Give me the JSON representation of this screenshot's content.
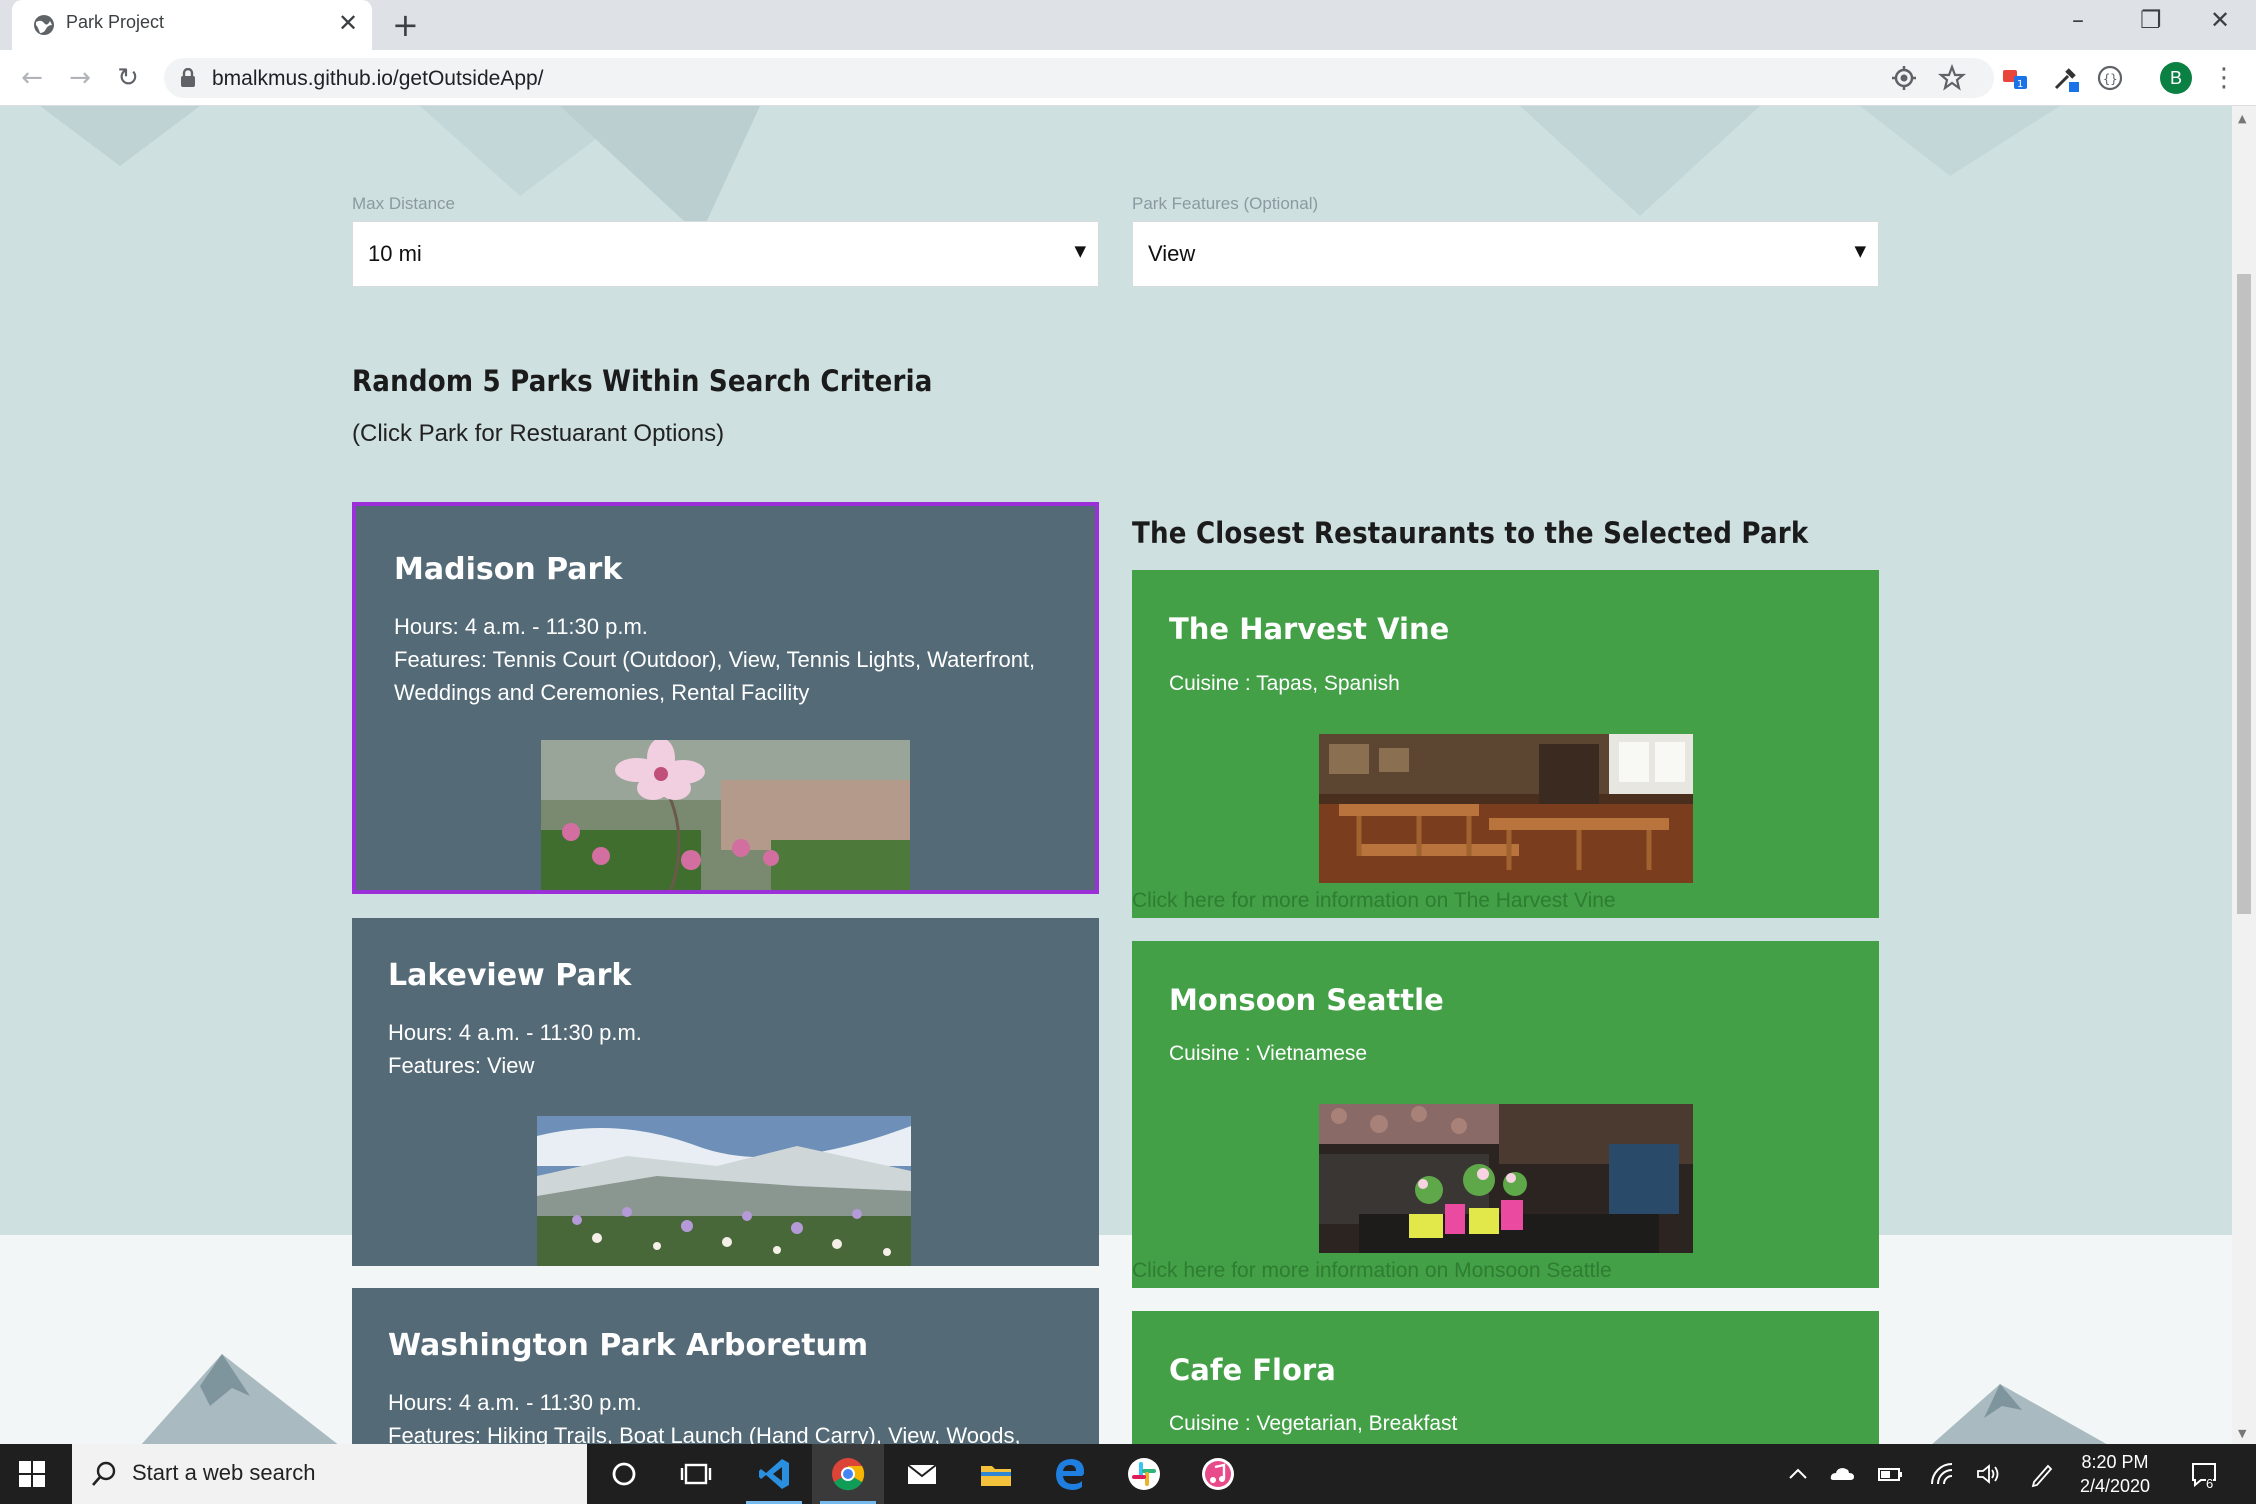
{
  "browser": {
    "tab_title": "Park Project",
    "url": "bmalkmus.github.io/getOutsideApp/",
    "profile_initial": "B"
  },
  "filters": {
    "distance_label": "Max Distance",
    "distance_value": "10 mi",
    "features_label": "Park Features (Optional)",
    "features_value": "View"
  },
  "parks_section": {
    "heading": "Random 5 Parks Within Search Criteria",
    "subheading": "(Click Park for Restuarant Options)"
  },
  "parks": [
    {
      "name": "Madison Park",
      "hours": "Hours: 4 a.m. - 11:30 p.m.",
      "features": "Features: Tennis Court (Outdoor), View, Tennis Lights, Waterfront, Weddings and Ceremonies, Rental Facility",
      "selected": true
    },
    {
      "name": "Lakeview Park",
      "hours": "Hours: 4 a.m. - 11:30 p.m.",
      "features": "Features: View",
      "selected": false
    },
    {
      "name": "Washington Park Arboretum",
      "hours": "Hours: 4 a.m. - 11:30 p.m.",
      "features": "Features: Hiking Trails, Boat Launch (Hand Carry), View, Woods,",
      "selected": false
    }
  ],
  "restaurants_section": {
    "heading": "The Closest Restaurants to the Selected Park"
  },
  "restaurants": [
    {
      "name": "The Harvest Vine",
      "cuisine": "Cuisine : Tapas, Spanish",
      "link": "Click here for more information on The Harvest Vine"
    },
    {
      "name": "Monsoon Seattle",
      "cuisine": "Cuisine : Vietnamese",
      "link": "Click here for more information on Monsoon Seattle"
    },
    {
      "name": "Cafe Flora",
      "cuisine": "Cuisine : Vegetarian, Breakfast",
      "link": ""
    }
  ],
  "taskbar": {
    "search_placeholder": "Start a web search",
    "time": "8:20 PM",
    "date": "2/4/2020",
    "notification_count": "6"
  },
  "colors": {
    "page_bg": "#cfe0e0",
    "park_card": "#546a77",
    "selected_border": "#9b30d9",
    "restaurant_card": "#43a047",
    "link": "#2e7d32"
  }
}
